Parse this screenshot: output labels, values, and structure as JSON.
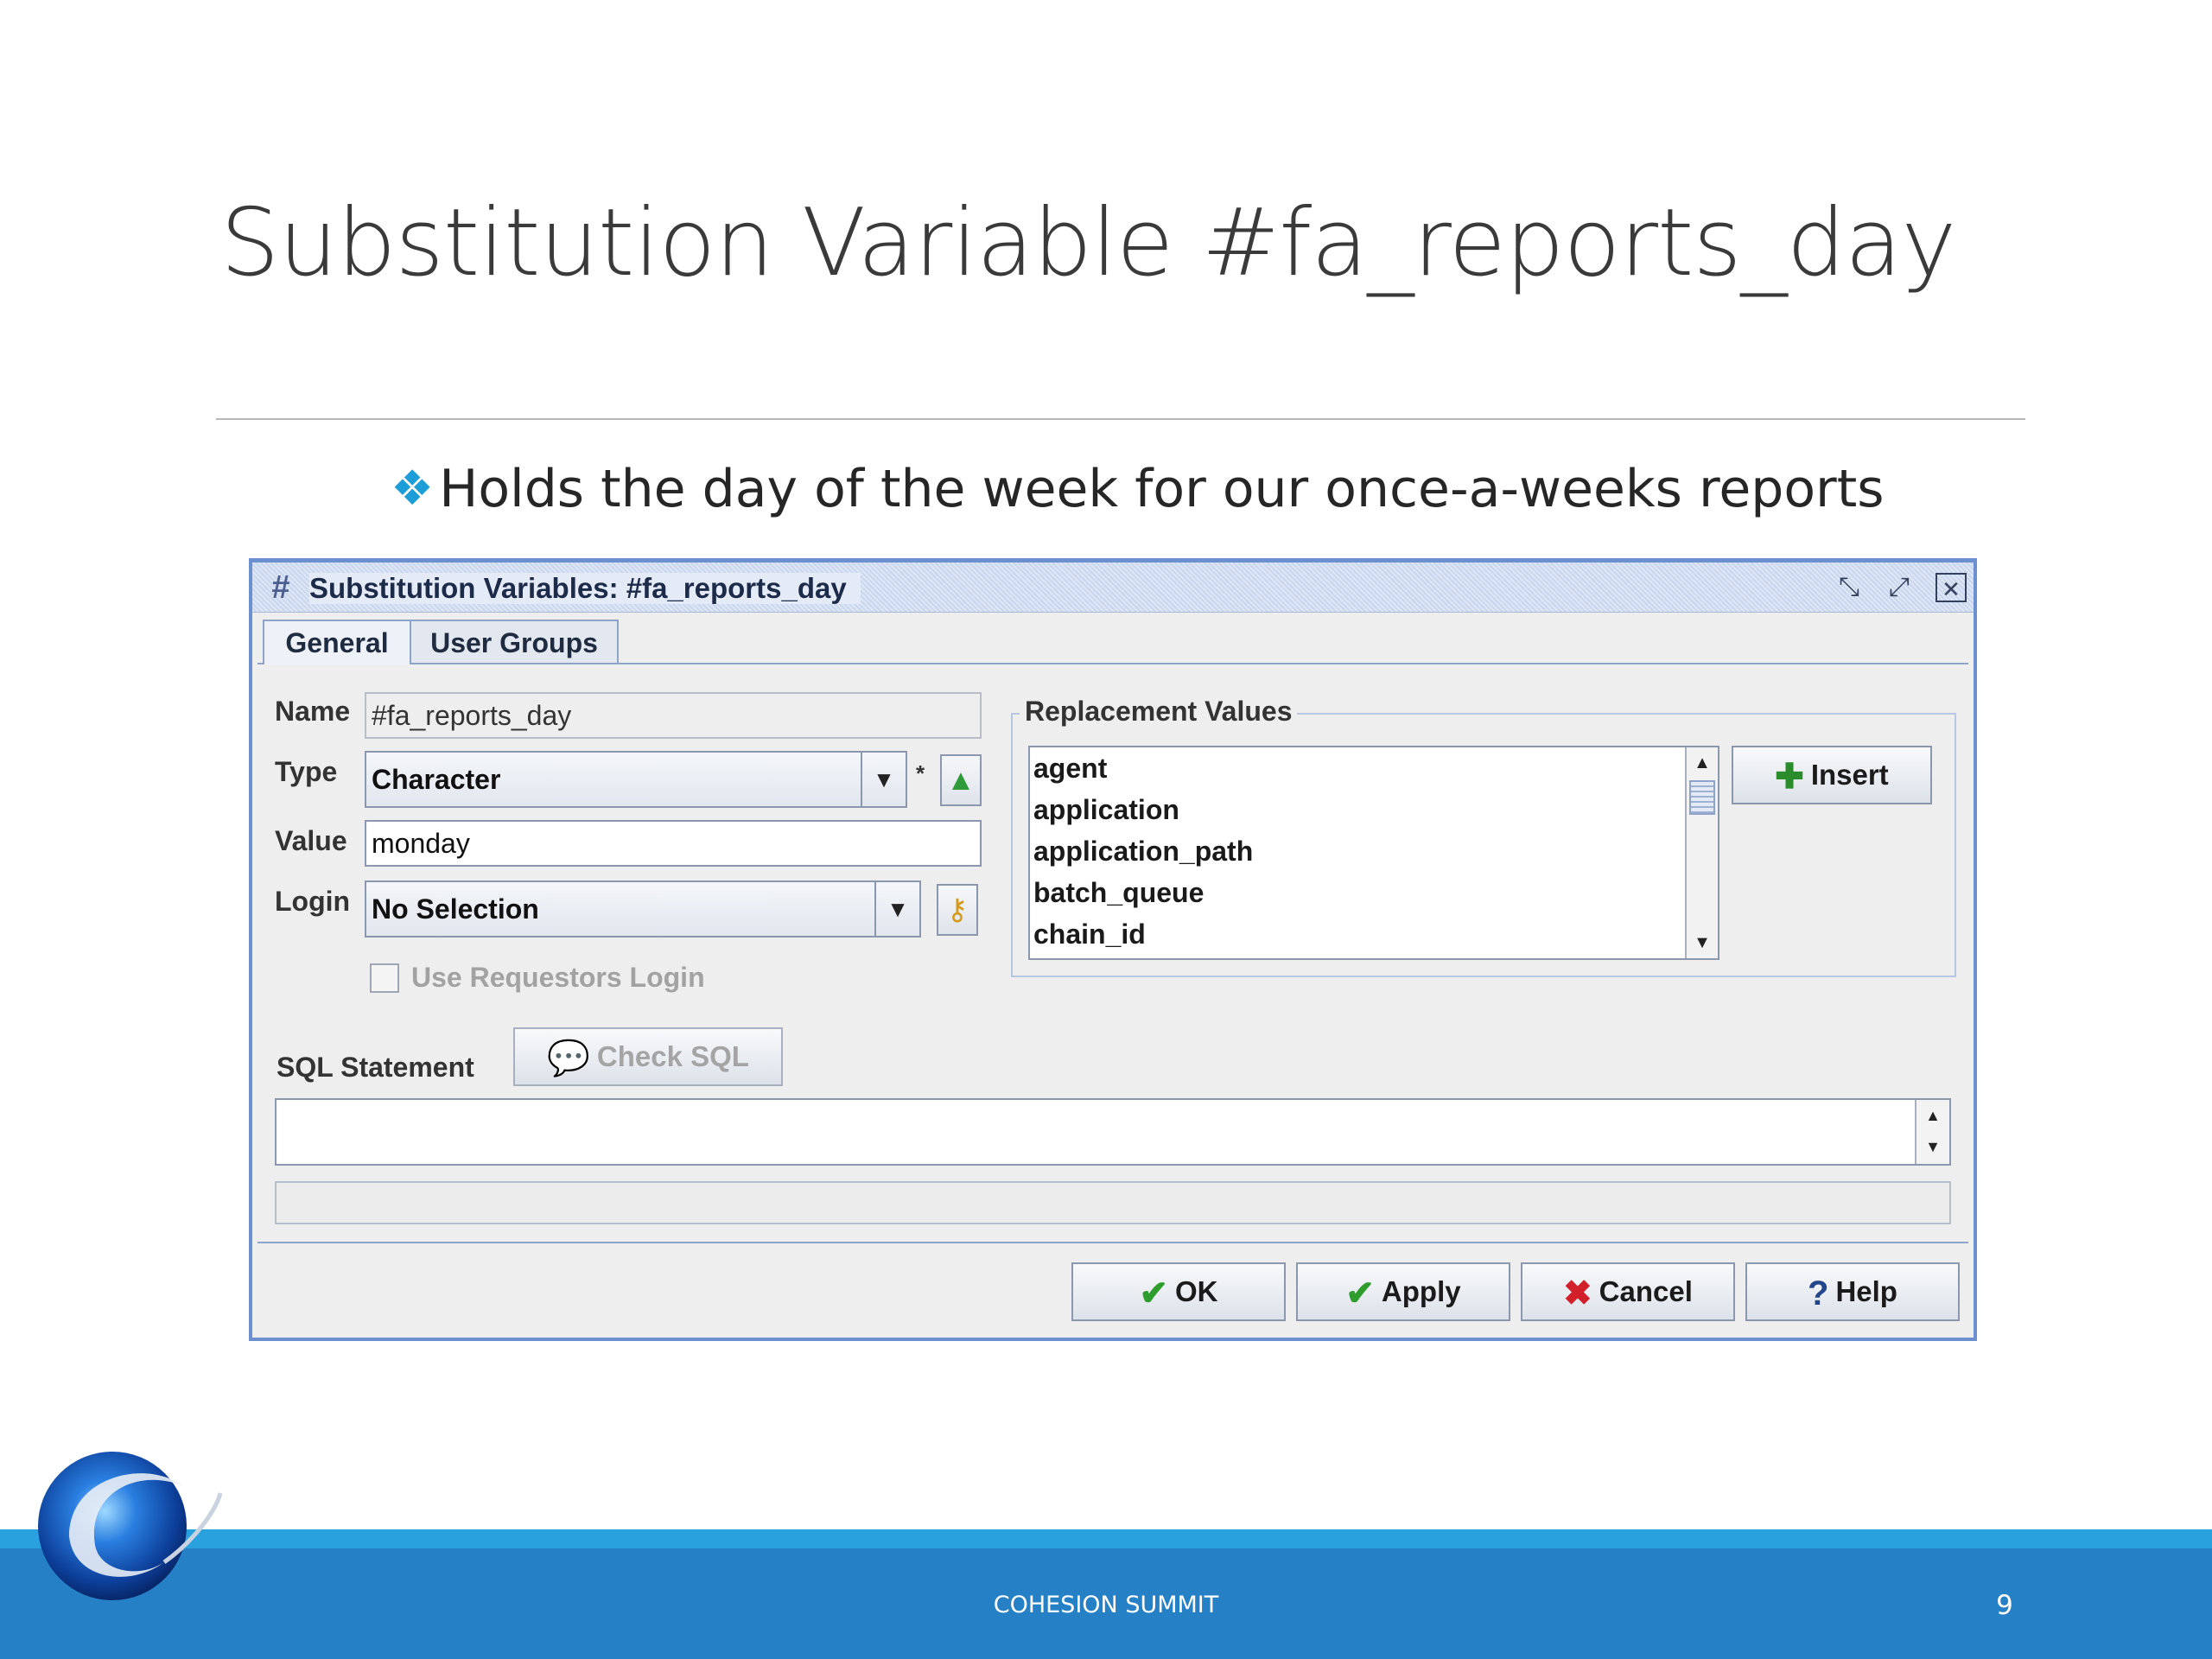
{
  "slide": {
    "title": "Substitution Variable #fa_reports_day",
    "bullet": "Holds the day of the week for our once-a-weeks reports",
    "footer": "COHESION SUMMIT",
    "page_number": "9"
  },
  "dialog": {
    "title": "Substitution Variables: #fa_reports_day",
    "tabs": [
      {
        "label": "General",
        "active": true
      },
      {
        "label": "User Groups",
        "active": false
      }
    ],
    "fields": {
      "name_label": "Name",
      "name_value": "#fa_reports_day",
      "type_label": "Type",
      "type_value": "Character",
      "type_required": "*",
      "value_label": "Value",
      "value_value": "monday",
      "login_label": "Login",
      "login_value": "No Selection",
      "use_requestors_login": "Use Requestors Login",
      "use_requestors_checked": false
    },
    "replacement": {
      "title": "Replacement Values",
      "items": [
        "agent",
        "application",
        "application_path",
        "batch_queue",
        "chain_id"
      ],
      "insert_label": "Insert"
    },
    "sql": {
      "label": "SQL Statement",
      "check_label": "Check SQL",
      "value": ""
    },
    "buttons": {
      "ok": "OK",
      "apply": "Apply",
      "cancel": "Cancel",
      "help": "Help"
    },
    "colors": {
      "frame": "#6c8fcf",
      "ok_check": "#2e9d2e",
      "cancel_x": "#d2202a"
    }
  },
  "colors": {
    "footer_bar": "#2580c5",
    "footer_line": "#2aa1df",
    "bullet": "#1e9ed8"
  }
}
